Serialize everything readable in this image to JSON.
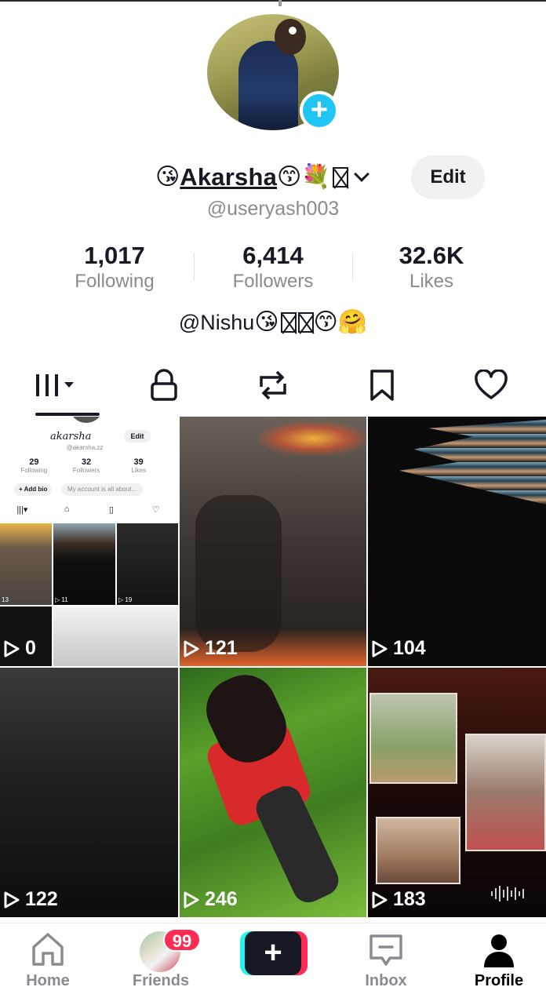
{
  "profile": {
    "name": "Akarsha",
    "username": "@useryash003",
    "edit_label": "Edit",
    "bio_text": "@Nishu"
  },
  "stats": [
    {
      "value": "1,017",
      "label": "Following"
    },
    {
      "value": "6,414",
      "label": "Followers"
    },
    {
      "value": "32.6K",
      "label": "Likes"
    }
  ],
  "tabs": [
    "videos-tab",
    "private-tab",
    "reposts-tab",
    "favorites-tab",
    "liked-tab"
  ],
  "videos": [
    {
      "views": "0"
    },
    {
      "views": "121"
    },
    {
      "views": "104"
    },
    {
      "views": "122"
    },
    {
      "views": "246"
    },
    {
      "views": "183"
    }
  ],
  "mini_profile": {
    "name": "akarsha",
    "username": "@akarsha.zz",
    "edit_label": "Edit",
    "stats": [
      {
        "value": "29",
        "label": "Following"
      },
      {
        "value": "32",
        "label": "Followers"
      },
      {
        "value": "39",
        "label": "Likes"
      }
    ],
    "add_bio_label": "+ Add bio",
    "account_hint": "My account is all about...",
    "thumb_views": [
      "13",
      "11",
      "19"
    ]
  },
  "nav": {
    "home": "Home",
    "friends": "Friends",
    "friends_badge": "99",
    "inbox": "Inbox",
    "profile": "Profile"
  },
  "colors": {
    "accent_blue": "#20c5f3",
    "badge_red": "#fe2c55",
    "post_cyan": "#25f4ee",
    "text_dark": "#161823",
    "text_gray": "#8a8b91"
  }
}
